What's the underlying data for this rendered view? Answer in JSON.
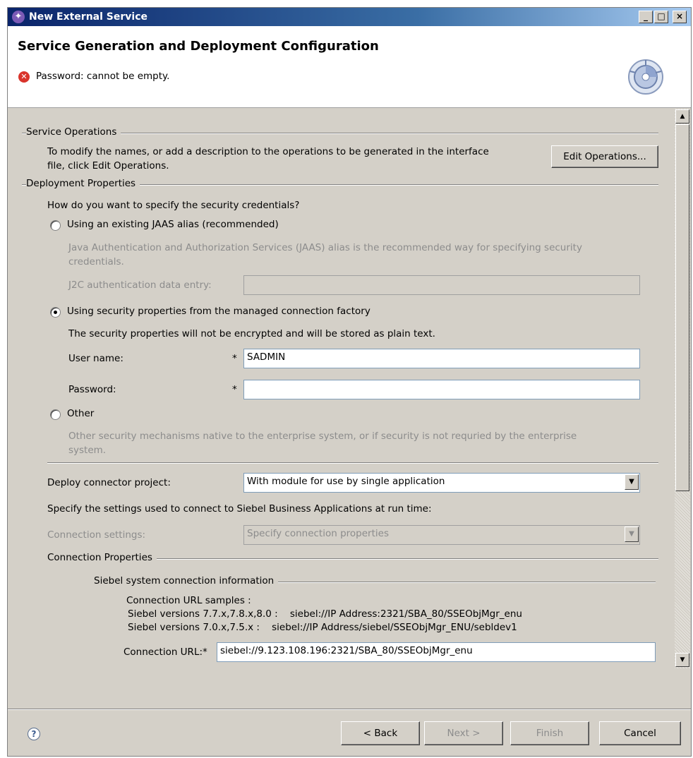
{
  "window": {
    "title": "New External Service",
    "minimize": "_",
    "maximize": "□",
    "close": "×"
  },
  "header": {
    "page_title": "Service Generation and Deployment Configuration",
    "error_message": "Password: cannot be empty."
  },
  "service_operations": {
    "label": "Service Operations",
    "description_line1": "To modify the names, or add a description to the operations to be generated in the interface",
    "description_line2": "file, click Edit Operations.",
    "edit_button": "Edit Operations..."
  },
  "deployment": {
    "label": "Deployment Properties",
    "question": "How do you want to specify the security credentials?",
    "option_jaas": "Using an existing JAAS alias (recommended)",
    "jaas_desc_line1": "Java Authentication and Authorization Services (JAAS) alias is the recommended way for specifying security",
    "jaas_desc_line2": "credentials.",
    "j2c_label": "J2C authentication data entry:",
    "j2c_value": "",
    "option_mcf": "Using security properties from the managed connection factory",
    "mcf_desc": "The security properties will not be encrypted and will be stored as plain text.",
    "username_label": "User name:",
    "username_value": "SADMIN",
    "password_label": "Password:",
    "password_value": "",
    "required_marker": "*",
    "option_other": "Other",
    "other_desc_line1": "Other security mechanisms native to the enterprise system, or if security is not requried by the enterprise",
    "other_desc_line2": "system.",
    "deploy_label": "Deploy connector project:",
    "deploy_value": "With module for use by single application",
    "runtime_text": "Specify the settings used to connect to Siebel Business Applications at run time:",
    "conn_settings_label": "Connection settings:",
    "conn_settings_value": "Specify connection properties"
  },
  "connection": {
    "label": "Connection Properties",
    "siebel_label": "Siebel system connection information",
    "samples_title": "Connection URL samples :",
    "sample1": "Siebel versions 7.7.x,7.8.x,8.0 :    siebel://IP Address:2321/SBA_80/SSEObjMgr_enu",
    "sample2": "Siebel versions 7.0.x,7.5.x :    siebel://IP Address/siebel/SSEObjMgr_ENU/sebldev1",
    "url_label": "Connection URL:*",
    "url_value": "siebel://9.123.108.196:2321/SBA_80/SSEObjMgr_enu"
  },
  "footer": {
    "back": "< Back",
    "next": "Next >",
    "finish": "Finish",
    "cancel": "Cancel"
  },
  "icons": {
    "error": "error-icon",
    "help": "help-icon",
    "banner": "wizard-banner-icon"
  }
}
